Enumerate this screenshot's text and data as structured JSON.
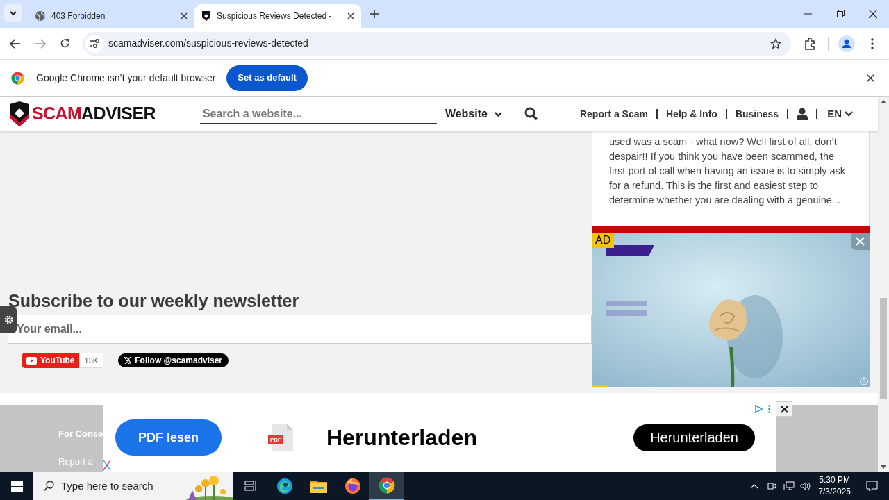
{
  "browser": {
    "tabs": [
      {
        "title": "403 Forbidden",
        "selected": false
      },
      {
        "title": "Suspicious Reviews Detected -",
        "selected": true
      }
    ],
    "url": "scamadviser.com/suspicious-reviews-detected",
    "infobar": {
      "message": "Google Chrome isn’t your default browser",
      "button": "Set as default"
    }
  },
  "site_header": {
    "logo_red": "SCAM",
    "logo_dark": "ADVISER",
    "search_placeholder": "Search a website...",
    "search_type": "Website",
    "nav": [
      "Report a Scam",
      "Help & Info",
      "Business"
    ],
    "language": "EN"
  },
  "article_excerpt": {
    "text": "used was a scam - what now? Well first of all, don’t despair!! If you think you have been scammed, the first port of call when having an issue is to simply ask for a refund. This is the first and easiest step to determine whether you are dealing with a genuine..."
  },
  "side_ad": {
    "label": "AD"
  },
  "newsletter": {
    "heading": "Subscribe to our weekly newsletter",
    "placeholder": "Your email..."
  },
  "social": {
    "youtube": "YouTube",
    "youtube_count": "13K",
    "x_follow": "Follow @scamadviser"
  },
  "footer": {
    "heading": "For Conse",
    "link": "Report a"
  },
  "bottom_ad": {
    "button": "PDF lesen",
    "file_badge": "PDF",
    "headline": "Herunterladen",
    "cta": "Herunterladen"
  },
  "taskbar": {
    "search_placeholder": "Type here to search",
    "apps": [
      {
        "kind": "taskview",
        "selected": false
      },
      {
        "kind": "edge",
        "selected": false
      },
      {
        "kind": "explorer",
        "selected": false
      },
      {
        "kind": "firefox",
        "selected": false
      },
      {
        "kind": "chrome",
        "selected": true
      }
    ],
    "time": "5:30 PM",
    "date": "7/3/2025"
  }
}
